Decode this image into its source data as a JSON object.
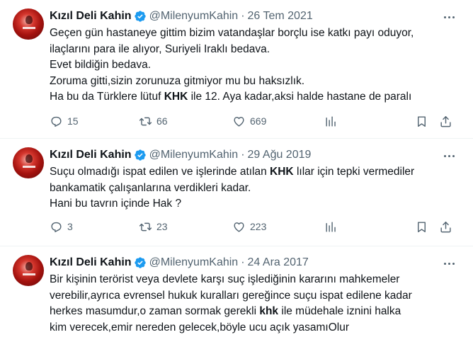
{
  "tweets": [
    {
      "author": "Kızıl Deli Kahin",
      "handle": "@MilenyumKahin",
      "separator": "·",
      "date": "26 Tem 2021",
      "lines": [
        [
          {
            "t": "Geçen gün hastaneye gittim bizim vatandaşlar borçlu ise katkı payı oduyor,"
          }
        ],
        [
          {
            "t": "ilaçlarını para ile alıyor, Suriyeli Iraklı bedava."
          }
        ],
        [
          {
            "t": "Evet bildiğin bedava."
          }
        ],
        [
          {
            "t": "Zoruma gitti,sizin zorunuza gitmiyor mu bu haksızlık."
          }
        ],
        [
          {
            "t": "Ha bu da Türklere lütuf "
          },
          {
            "t": "KHK",
            "b": true
          },
          {
            "t": " ile 12. Aya kadar,aksi halde hastane de paralı"
          }
        ]
      ],
      "replies": "15",
      "retweets": "66",
      "likes": "669"
    },
    {
      "author": "Kızıl Deli Kahin",
      "handle": "@MilenyumKahin",
      "separator": "·",
      "date": "29 Ağu 2019",
      "lines": [
        [
          {
            "t": "Suçu olmadığı ispat edilen ve işlerinde atılan "
          },
          {
            "t": "KHK",
            "b": true
          },
          {
            "t": " lılar için tepki vermediler"
          }
        ],
        [
          {
            "t": "bankamatik çalışanlarına verdikleri kadar."
          }
        ],
        [
          {
            "t": "Hani bu tavrın içinde Hak ?"
          }
        ]
      ],
      "replies": "3",
      "retweets": "23",
      "likes": "223"
    },
    {
      "author": "Kızıl Deli Kahin",
      "handle": "@MilenyumKahin",
      "separator": "·",
      "date": "24 Ara 2017",
      "lines": [
        [
          {
            "t": "Bir kişinin terörist veya devlete karşı suç işlediğinin kararını mahkemeler"
          }
        ],
        [
          {
            "t": "verebilir,ayrıca evrensel hukuk kuralları gereğince suçu ispat edilene kadar"
          }
        ],
        [
          {
            "t": "herkes masumdur,o zaman sormak gerekli "
          },
          {
            "t": "khk",
            "b": true
          },
          {
            "t": " ile müdehale iznini halka"
          }
        ],
        [
          {
            "t": "kim verecek,emir nereden gelecek,böyle ucu açık yasamıOlur"
          }
        ]
      ]
    }
  ],
  "icons": {
    "more": "more-horizontal-icon",
    "verified": "verified-badge-icon",
    "reply": "reply-icon",
    "retweet": "retweet-icon",
    "like": "heart-icon",
    "views": "analytics-icon",
    "bookmark": "bookmark-icon",
    "share": "share-icon"
  },
  "colors": {
    "verified": "#1d9bf0",
    "secondary_text": "#536471",
    "text": "#0f1419"
  }
}
